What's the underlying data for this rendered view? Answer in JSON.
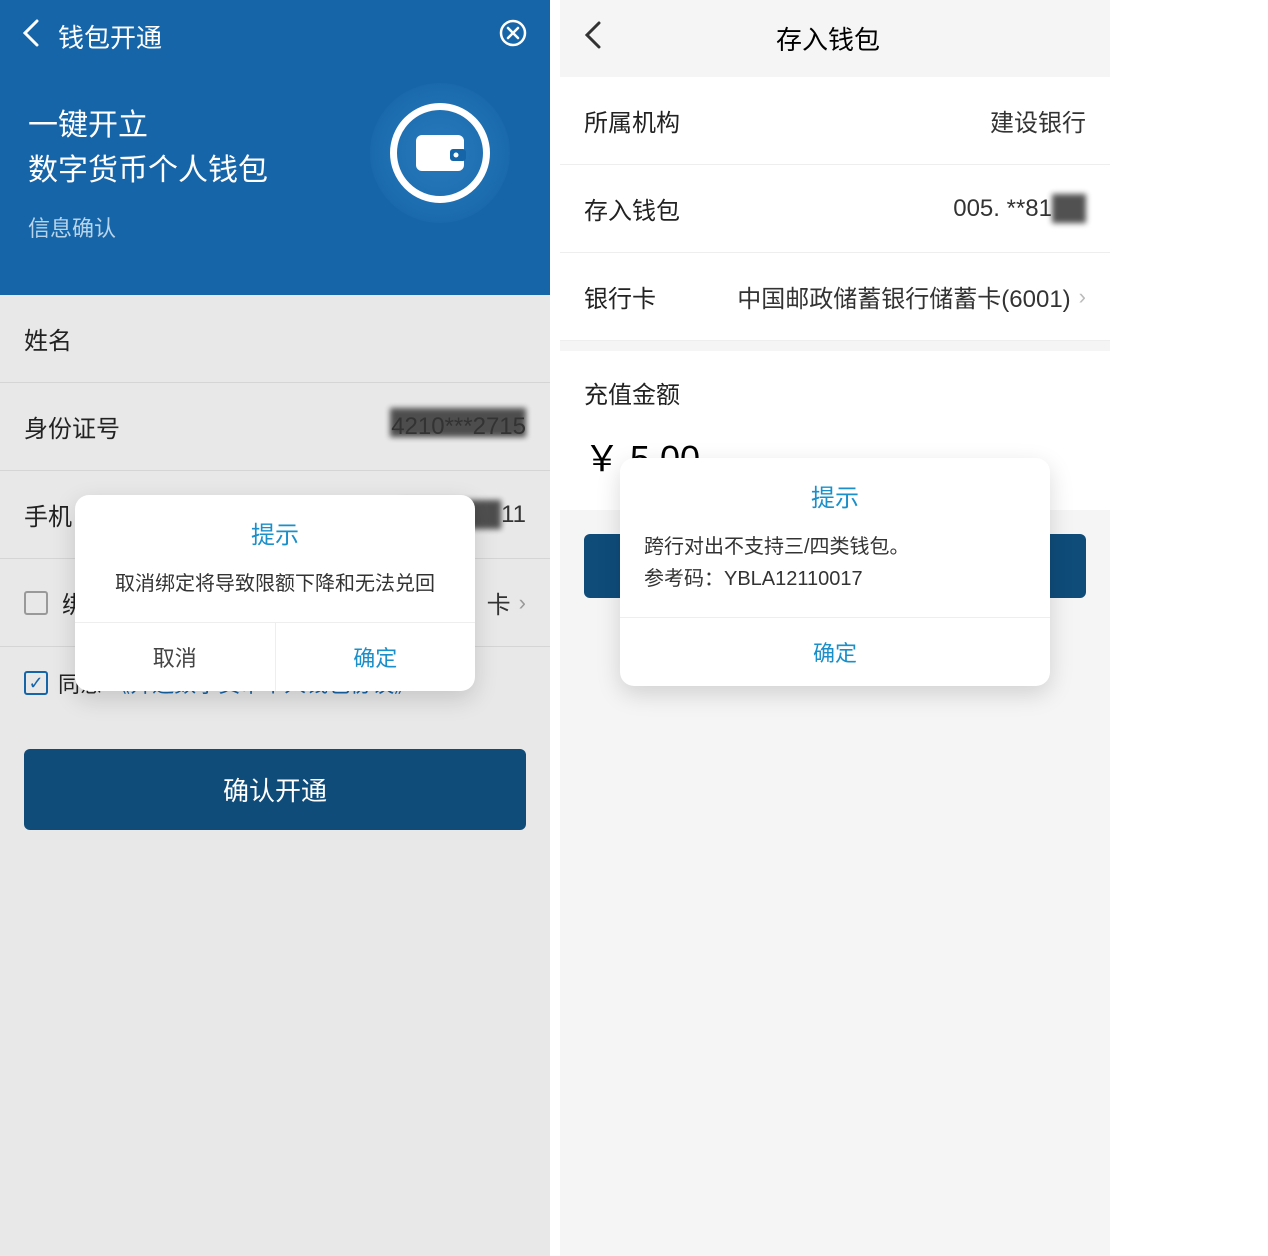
{
  "left": {
    "header_title": "钱包开通",
    "hero_line1": "一键开立",
    "hero_line2": "数字货币个人钱包",
    "hero_sub": "信息确认",
    "rows": {
      "name_label": "姓名",
      "id_label": "身份证号",
      "id_value_masked": "4210***2715",
      "phone_label": "手机",
      "phone_value_partial": "11",
      "bind_checkbox_label": "绑",
      "bind_label_suffix": "卡"
    },
    "agree": {
      "agree_text": "同意",
      "agreement_link": "《开通数字货币个人钱包协议》"
    },
    "confirm_button": "确认开通",
    "dialog": {
      "title": "提示",
      "message": "取消绑定将导致限额下降和无法兑回",
      "cancel": "取消",
      "ok": "确定"
    }
  },
  "right": {
    "header_title": "存入钱包",
    "rows": {
      "org_label": "所属机构",
      "org_value": "建设银行",
      "wallet_label": "存入钱包",
      "wallet_value_masked": "005. **81",
      "card_label": "银行卡",
      "card_value": "中国邮政储蓄银行储蓄卡(6001)"
    },
    "amount_label": "充值金额",
    "currency_symbol": "￥",
    "amount_value": "5.00",
    "dialog": {
      "title": "提示",
      "message_line1": "跨行对出不支持三/四类钱包。",
      "message_line2_prefix": "参考码：",
      "message_line2_code": "YBLA12110017",
      "ok": "确定"
    }
  }
}
